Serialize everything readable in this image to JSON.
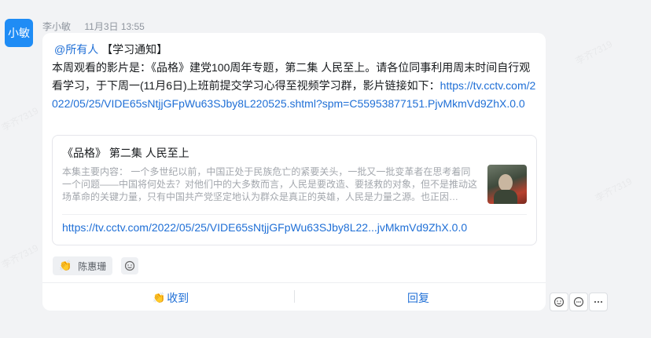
{
  "sender": {
    "avatar_text": "小敏",
    "name": "李小敏",
    "time": "11月3日 13:55"
  },
  "message": {
    "mention": "@所有人",
    "tag": "【学习通知】",
    "body": "本周观看的影片是：《品格》建党100周年专题，第二集 人民至上。请各位同事利用周末时间自行观看学习，于下周一(11月6日)上班前提交学习心得至视频学习群，影片链接如下：",
    "url": "https://tv.cctv.com/2022/05/25/VIDE65sNtjjGFpWu63SJby8L220525.shtml?spm=C55953877151.PjvMkmVd9ZhX.0.0"
  },
  "preview": {
    "title": "《品格》 第二集 人民至上",
    "description": "本集主要内容：  一个多世纪以前，中国正处于民族危亡的紧要关头，一批又一批变革者在思考着同一个问题——中国将何处去？对他们中的大多数而言，人民是要改造、要拯救的对象，但不是推动这场革命的关键力量，只有中国共产党坚定地认为群众是真正的英雄，人民是力量之源。也正因…",
    "link_short": "https://tv.cctv.com/2022/05/25/VIDE65sNtjjGFpWu63SJby8L22...jvMkmVd9ZhX.0.0"
  },
  "reactions": [
    {
      "icon": "clap-icon",
      "user": "陈惠珊"
    }
  ],
  "actions": {
    "received": "收到",
    "reply": "回复"
  },
  "watermark": "李齐7319",
  "colors": {
    "accent": "#1f6fd6",
    "avatar_bg": "#1f8cf5"
  }
}
